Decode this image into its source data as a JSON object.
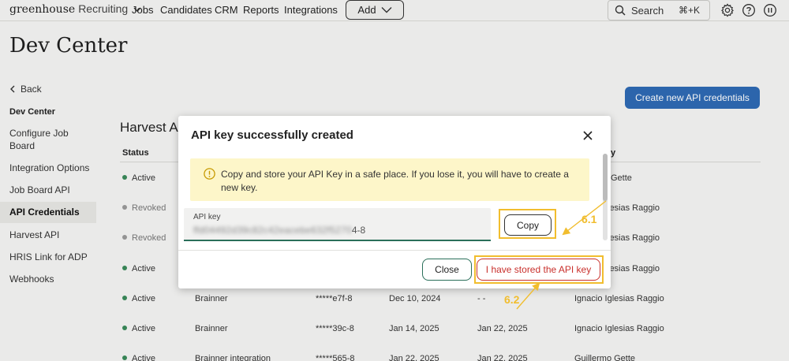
{
  "nav": {
    "logo_brand": "greenhouse",
    "logo_sub": "Recruiting",
    "links": [
      "Jobs",
      "Candidates",
      "CRM",
      "Reports",
      "Integrations"
    ],
    "add_label": "Add",
    "search_placeholder": "Search",
    "search_shortcut": "⌘+K"
  },
  "page": {
    "title": "Dev Center",
    "back_label": "Back"
  },
  "sidebar": {
    "heading": "Dev Center",
    "items": [
      {
        "label": "Configure Job Board"
      },
      {
        "label": "Integration Options"
      },
      {
        "label": "Job Board API"
      },
      {
        "label": "API Credentials"
      },
      {
        "label": "Harvest API"
      },
      {
        "label": "HRIS Link for ADP"
      },
      {
        "label": "Webhooks"
      }
    ]
  },
  "main": {
    "create_button": "Create new API credentials",
    "section_title": "Harvest A",
    "columns": {
      "status": "Status",
      "last": "y"
    },
    "rows": [
      {
        "status": "Active",
        "col2": "",
        "col3": "",
        "col4": "",
        "col5": "",
        "owner": "Gette"
      },
      {
        "status": "Revoked",
        "col2": "",
        "col3": "",
        "col4": "",
        "col5": "",
        "owner": "lesias Raggio"
      },
      {
        "status": "Revoked",
        "col2": "",
        "col3": "",
        "col4": "",
        "col5": "",
        "owner": "lesias Raggio"
      },
      {
        "status": "Active",
        "col2": "",
        "col3": "",
        "col4": "",
        "col5": "",
        "owner": "lesias Raggio"
      },
      {
        "status": "Active",
        "col2": "Brainner",
        "col3": "*****e7f-8",
        "col4": "Dec 10, 2024",
        "col5": "- -",
        "owner": "Ignacio Iglesias Raggio"
      },
      {
        "status": "Active",
        "col2": "Brainner",
        "col3": "*****39c-8",
        "col4": "Jan 14, 2025",
        "col5": "Jan 22, 2025",
        "owner": "Ignacio Iglesias Raggio"
      },
      {
        "status": "Active",
        "col2": "Brainner integration",
        "col3": "*****565-8",
        "col4": "Jan 22, 2025",
        "col5": "Jan 22, 2025",
        "owner": "Guillermo Gette"
      }
    ]
  },
  "modal": {
    "title": "API key successfully created",
    "notice": "Copy and store your API Key in a safe place. If you lose it, you will have to create a new key.",
    "key_label": "API key",
    "key_hidden": "ffd04492d39c82c42eacebe632f5270",
    "key_visible": "4-8",
    "copy_label": "Copy",
    "close_label": "Close",
    "stored_label": "I have stored the API key"
  },
  "annotations": {
    "step1": "6.1",
    "step2": "6.2",
    "color": "#f1bd2e"
  }
}
